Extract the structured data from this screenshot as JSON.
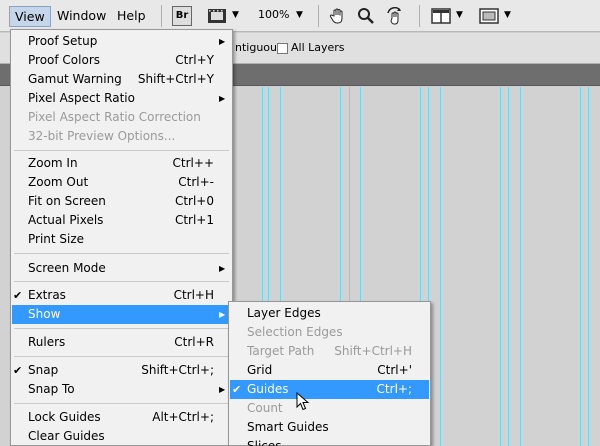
{
  "menubar": {
    "items": [
      {
        "label": "View"
      },
      {
        "label": "Window"
      },
      {
        "label": "Help"
      }
    ],
    "bridge_label": "Br",
    "zoom_level": "100%"
  },
  "options": {
    "contiguous_label": "ntiguous",
    "all_layers_label": "All Layers"
  },
  "view_menu": {
    "items": [
      {
        "label": "Proof Setup",
        "shortcut": "",
        "submenu": true
      },
      {
        "label": "Proof Colors",
        "shortcut": "Ctrl+Y"
      },
      {
        "label": "Gamut Warning",
        "shortcut": "Shift+Ctrl+Y"
      },
      {
        "label": "Pixel Aspect Ratio",
        "shortcut": "",
        "submenu": true
      },
      {
        "label": "Pixel Aspect Ratio Correction",
        "shortcut": "",
        "disabled": true
      },
      {
        "label": "32-bit Preview Options...",
        "shortcut": "",
        "disabled": true
      },
      {
        "label": "Zoom In",
        "shortcut": "Ctrl++"
      },
      {
        "label": "Zoom Out",
        "shortcut": "Ctrl+-"
      },
      {
        "label": "Fit on Screen",
        "shortcut": "Ctrl+0"
      },
      {
        "label": "Actual Pixels",
        "shortcut": "Ctrl+1"
      },
      {
        "label": "Print Size",
        "shortcut": ""
      },
      {
        "label": "Screen Mode",
        "shortcut": "",
        "submenu": true
      },
      {
        "label": "Extras",
        "shortcut": "Ctrl+H",
        "checked": true
      },
      {
        "label": "Show",
        "shortcut": "",
        "submenu": true,
        "highlighted": true
      },
      {
        "label": "Rulers",
        "shortcut": "Ctrl+R"
      },
      {
        "label": "Snap",
        "shortcut": "Shift+Ctrl+;",
        "checked": true
      },
      {
        "label": "Snap To",
        "shortcut": "",
        "submenu": true
      },
      {
        "label": "Lock Guides",
        "shortcut": "Alt+Ctrl+;"
      },
      {
        "label": "Clear Guides",
        "shortcut": ""
      }
    ]
  },
  "show_menu": {
    "items": [
      {
        "label": "Layer Edges",
        "shortcut": ""
      },
      {
        "label": "Selection Edges",
        "shortcut": "",
        "disabled": true
      },
      {
        "label": "Target Path",
        "shortcut": "Shift+Ctrl+H",
        "disabled": true
      },
      {
        "label": "Grid",
        "shortcut": "Ctrl+'"
      },
      {
        "label": "Guides",
        "shortcut": "Ctrl+;",
        "checked": true,
        "highlighted": true
      },
      {
        "label": "Count",
        "shortcut": "",
        "disabled": true
      },
      {
        "label": "Smart Guides",
        "shortcut": ""
      },
      {
        "label": "Slices",
        "shortcut": ""
      }
    ]
  },
  "colors": {
    "highlight": "#3399ff",
    "guide": "#6ad8f0",
    "disabled_text": "#9a9a9a"
  }
}
